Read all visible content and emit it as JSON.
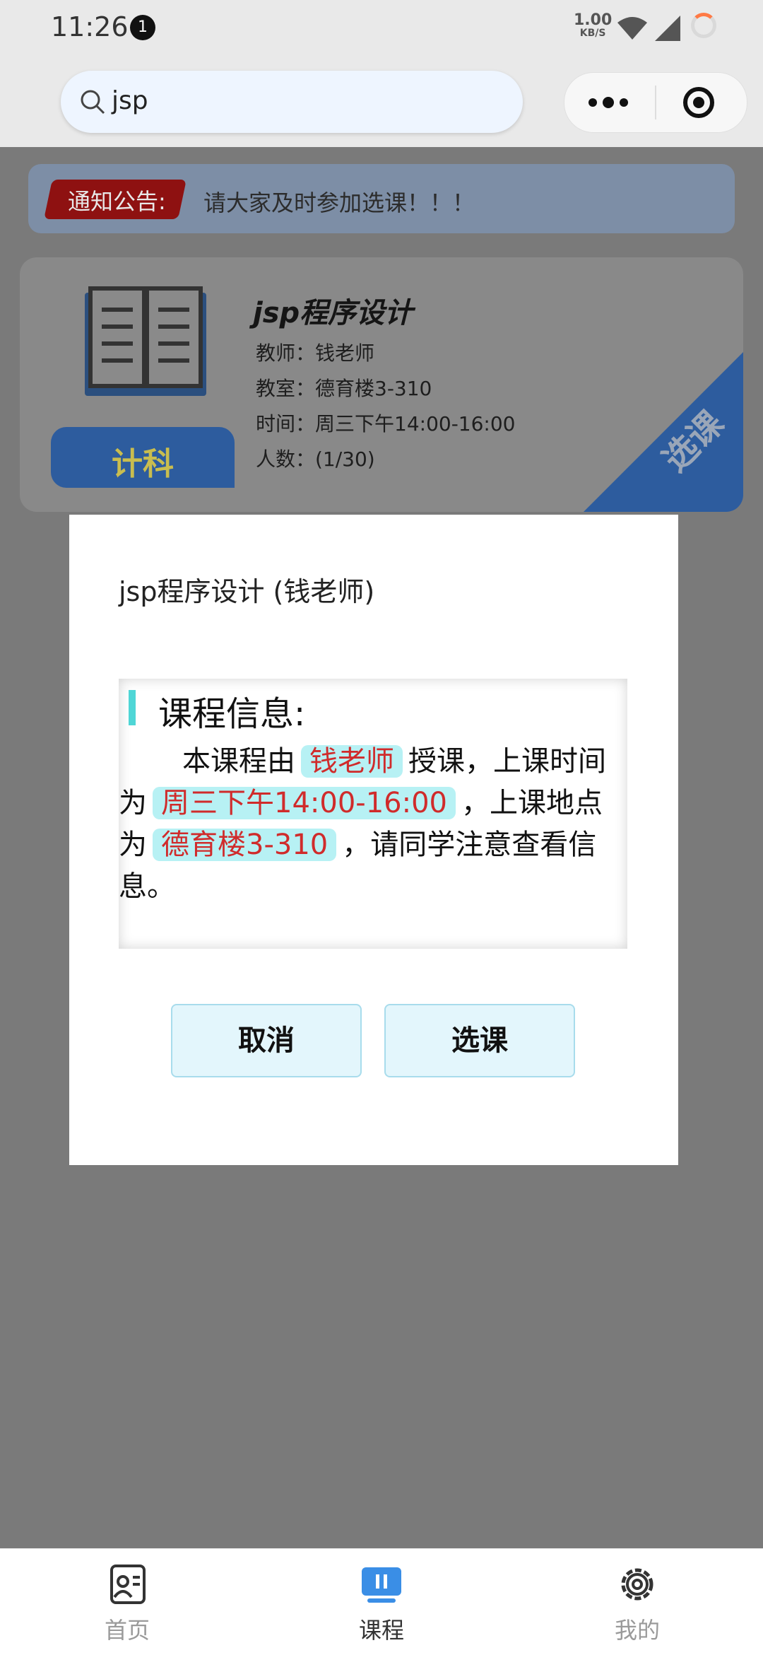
{
  "status_bar": {
    "time": "11:26",
    "notification_count": "1",
    "net_speed_value": "1.00",
    "net_speed_unit": "KB/S"
  },
  "search": {
    "query": "jsp"
  },
  "notice": {
    "tag": "通知公告:",
    "text": "请大家及时参加选课！！！"
  },
  "course_card": {
    "badge": "计科",
    "title": "jsp程序设计",
    "teacher": "教师：钱老师",
    "classroom": "教室：德育楼3-310",
    "time": "时间：周三下午14:00-16:00",
    "enrollment": "人数：(1/30)",
    "select_ribbon": "选课"
  },
  "modal": {
    "title": "jsp程序设计 (钱老师)",
    "info_heading": "课程信息:",
    "para_prefix": "本课程由",
    "teacher": "钱老师",
    "para_mid1": "授课，上课时间为",
    "time": "周三下午14:00-16:00",
    "para_mid2": "，上课地点为",
    "location": "德育楼3-310",
    "para_suffix": "，请同学注意查看信息。",
    "cancel_label": "取消",
    "confirm_label": "选课"
  },
  "tabbar": {
    "items": [
      {
        "label": "首页",
        "icon": "home-profile-icon",
        "active": false
      },
      {
        "label": "课程",
        "icon": "course-board-icon",
        "active": true
      },
      {
        "label": "我的",
        "icon": "gear-icon",
        "active": false
      }
    ]
  },
  "colors": {
    "accent": "#2d5c9e",
    "highlight_bg": "#b7f1f4",
    "highlight_text": "#d02b2b",
    "tab_active": "#3a8ee6"
  }
}
